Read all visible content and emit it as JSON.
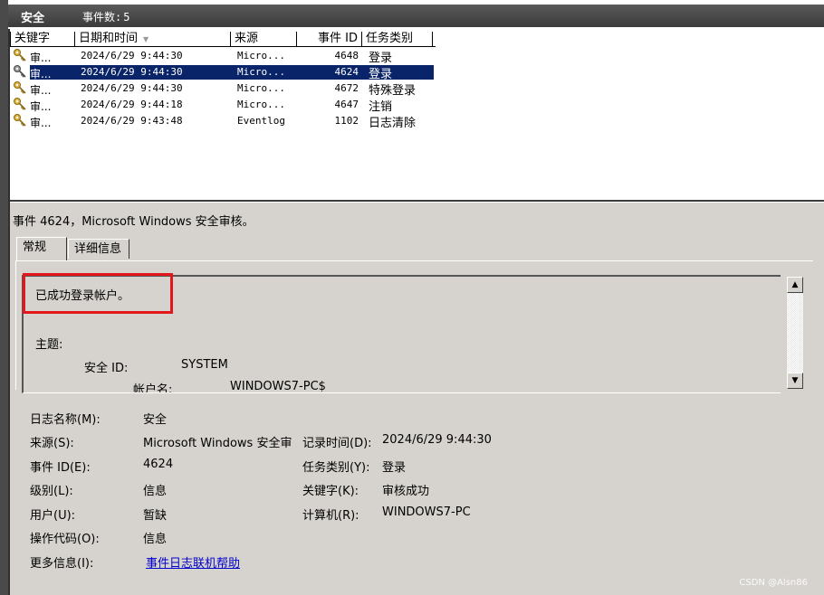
{
  "header": {
    "title": "安全",
    "count_label": "事件数:",
    "count": "5"
  },
  "columns": [
    "关键字",
    "日期和时间",
    "来源",
    "事件 ID",
    "任务类别"
  ],
  "events": [
    {
      "keyword": "审...",
      "datetime": "2024/6/29 9:44:30",
      "source": "Micro...",
      "event_id": "4648",
      "category": "登录",
      "selected": false
    },
    {
      "keyword": "审...",
      "datetime": "2024/6/29 9:44:30",
      "source": "Micro...",
      "event_id": "4624",
      "category": "登录",
      "selected": true
    },
    {
      "keyword": "审...",
      "datetime": "2024/6/29 9:44:30",
      "source": "Micro...",
      "event_id": "4672",
      "category": "特殊登录",
      "selected": false
    },
    {
      "keyword": "审...",
      "datetime": "2024/6/29 9:44:18",
      "source": "Micro...",
      "event_id": "4647",
      "category": "注销",
      "selected": false
    },
    {
      "keyword": "审...",
      "datetime": "2024/6/29 9:43:48",
      "source": "Eventlog",
      "event_id": "1102",
      "category": "日志清除",
      "selected": false
    }
  ],
  "detail": {
    "title": "事件 4624，Microsoft Windows 安全审核。",
    "tabs": [
      "常规",
      "详细信息"
    ],
    "description": {
      "line1": "已成功登录帐户。",
      "subject_label": "主题:",
      "security_id_label": "安全 ID:",
      "security_id_value": "SYSTEM",
      "account_name_label": "帐户名:",
      "account_name_value": "WINDOWS7-PC$"
    },
    "fields": {
      "log_name_label": "日志名称(M):",
      "log_name_value": "安全",
      "source_label": "来源(S):",
      "source_value": "Microsoft Windows 安全审",
      "logged_label": "记录时间(D):",
      "logged_value": "2024/6/29 9:44:30",
      "event_id_label": "事件 ID(E):",
      "event_id_value": "4624",
      "task_label": "任务类别(Y):",
      "task_value": "登录",
      "level_label": "级别(L):",
      "level_value": "信息",
      "keywords_label": "关键字(K):",
      "keywords_value": "审核成功",
      "user_label": "用户(U):",
      "user_value": "暂缺",
      "computer_label": "计算机(R):",
      "computer_value": "WINDOWS7-PC",
      "opcode_label": "操作代码(O):",
      "opcode_value": "信息",
      "more_info_label": "更多信息(I):",
      "more_info_link": "事件日志联机帮助"
    }
  },
  "watermark": "CSDN @Alsn86",
  "icons": {
    "keyword": "key-icon",
    "scroll_up": "arrow-up-icon",
    "scroll_down": "arrow-down-icon"
  }
}
